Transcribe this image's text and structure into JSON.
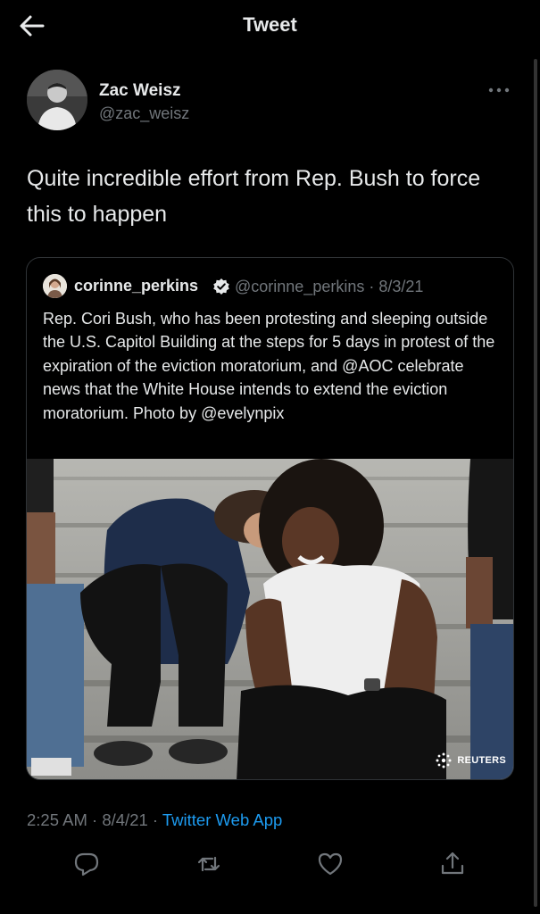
{
  "header": {
    "title": "Tweet",
    "back_icon": "arrow-left-icon"
  },
  "tweet": {
    "author_name": "Zac Weisz",
    "author_handle": "@zac_weisz",
    "text": "Quite incredible effort from Rep. Bush to force this to happen",
    "time": "2:25 AM",
    "separator1": "·",
    "date": "8/4/21",
    "separator2": "·",
    "source": "Twitter Web App"
  },
  "quoted_tweet": {
    "author_name": "corinne_perkins",
    "verified_icon": "verified-badge-icon",
    "meta": "@corinne_perkins · 8/3/21",
    "text": "Rep. Cori Bush, who has been protesting and sleeping outside the U.S. Capitol Building at the steps for 5 days in protest of the expiration of the eviction moratorium, and @AOC celebrate news that the White House intends to extend the eviction moratorium. Photo by @evelynpix",
    "photo_watermark": "REUTERS"
  },
  "actions": [
    "reply-icon",
    "retweet-icon",
    "like-icon",
    "share-icon"
  ],
  "colors": {
    "background": "#000000",
    "text": "#e7e9ea",
    "muted": "#71767b",
    "accent": "#1d9bf0",
    "border": "#2f3336"
  }
}
